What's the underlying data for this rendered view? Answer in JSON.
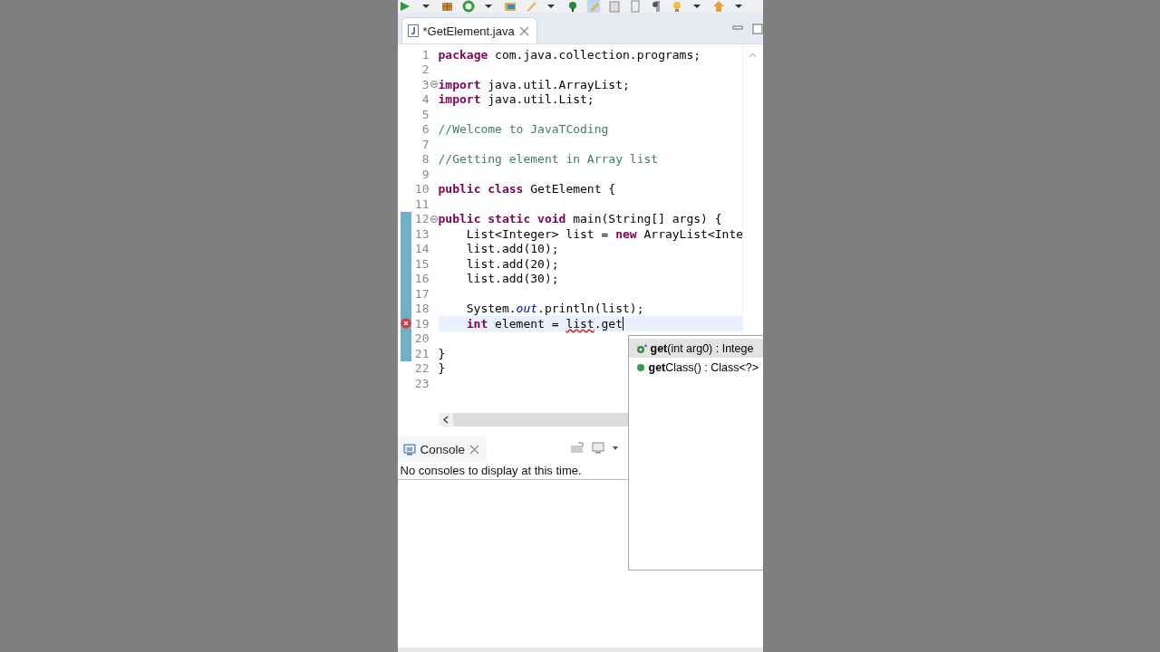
{
  "editor_tab": {
    "title": "*GetElement.java",
    "selected": true
  },
  "lines": [
    {
      "number": "1",
      "fold": false,
      "changed": false,
      "error": false,
      "current": false,
      "segments": [
        {
          "kind": "keyword",
          "text": "package"
        },
        {
          "kind": "plain",
          "text": " com.java.collection.programs;"
        }
      ]
    },
    {
      "number": "2",
      "fold": false,
      "changed": false,
      "error": false,
      "current": false
    },
    {
      "number": "3",
      "fold": true,
      "changed": false,
      "error": false,
      "current": false,
      "segments": [
        {
          "kind": "keyword",
          "text": "import"
        },
        {
          "kind": "plain",
          "text": " java.util.ArrayList;"
        }
      ]
    },
    {
      "number": "4",
      "fold": false,
      "changed": false,
      "error": false,
      "current": false,
      "segments": [
        {
          "kind": "keyword",
          "text": "import"
        },
        {
          "kind": "plain",
          "text": " java.util.List;"
        }
      ]
    },
    {
      "number": "5",
      "fold": false,
      "changed": false,
      "error": false,
      "current": false
    },
    {
      "number": "6",
      "fold": false,
      "changed": false,
      "error": false,
      "current": false,
      "segments": [
        {
          "kind": "comment",
          "text": "//Welcome to JavaTCoding"
        }
      ]
    },
    {
      "number": "7",
      "fold": false,
      "changed": false,
      "error": false,
      "current": false
    },
    {
      "number": "8",
      "fold": false,
      "changed": false,
      "error": false,
      "current": false,
      "segments": [
        {
          "kind": "comment",
          "text": "//Getting element in Array list"
        }
      ]
    },
    {
      "number": "9",
      "fold": false,
      "changed": false,
      "error": false,
      "current": false
    },
    {
      "number": "10",
      "fold": false,
      "changed": false,
      "error": false,
      "current": false,
      "segments": [
        {
          "kind": "keyword",
          "text": "public class"
        },
        {
          "kind": "plain",
          "text": " GetElement {"
        }
      ]
    },
    {
      "number": "11",
      "fold": false,
      "changed": false,
      "error": false,
      "current": false
    },
    {
      "number": "12",
      "fold": true,
      "changed": true,
      "error": false,
      "current": false,
      "segments": [
        {
          "kind": "keyword",
          "text": "public static void"
        },
        {
          "kind": "plain",
          "text": " main(String[] args) {"
        }
      ],
      "children": [
        {
          "number": "13",
          "fold": false,
          "changed": true,
          "error": false,
          "current": false,
          "segments": [
            {
              "kind": "plain",
              "text": "List<Integer> list = "
            },
            {
              "kind": "keyword",
              "text": "new"
            },
            {
              "kind": "plain",
              "text": " ArrayList<Inte"
            }
          ]
        },
        {
          "number": "14",
          "fold": false,
          "changed": true,
          "error": false,
          "current": false,
          "segments": [
            {
              "kind": "plain",
              "text": "list.add(10);"
            }
          ]
        },
        {
          "number": "15",
          "fold": false,
          "changed": true,
          "error": false,
          "current": false,
          "segments": [
            {
              "kind": "plain",
              "text": "list.add(20);"
            }
          ]
        },
        {
          "number": "16",
          "fold": false,
          "changed": true,
          "error": false,
          "current": false,
          "segments": [
            {
              "kind": "plain",
              "text": "list.add(30);"
            }
          ]
        },
        {
          "number": "17",
          "fold": false,
          "changed": true,
          "error": false,
          "current": false
        },
        {
          "number": "18",
          "fold": false,
          "changed": true,
          "error": false,
          "current": false,
          "segments": [
            {
              "kind": "plain",
              "text": "System."
            },
            {
              "kind": "field",
              "text": "out"
            },
            {
              "kind": "plain",
              "text": ".println(list);"
            }
          ]
        },
        {
          "number": "19",
          "fold": false,
          "changed": true,
          "error": true,
          "current": true,
          "segments": [
            {
              "kind": "keyword",
              "text": "int"
            },
            {
              "kind": "plain",
              "text": " element = "
            },
            {
              "kind": "error",
              "text": "list"
            },
            {
              "kind": "plain",
              "text": ".get"
            }
          ]
        },
        {
          "number": "20",
          "fold": false,
          "changed": true,
          "error": false,
          "current": false
        }
      ]
    },
    {
      "number": "21",
      "fold": false,
      "changed": true,
      "error": false,
      "current": false,
      "segments": [
        {
          "kind": "plain",
          "text": "}"
        }
      ]
    },
    {
      "number": "22",
      "fold": false,
      "changed": false,
      "error": false,
      "current": false,
      "segments": [
        {
          "kind": "plain",
          "text": "}"
        }
      ]
    },
    {
      "number": "23",
      "fold": false,
      "changed": false,
      "error": false,
      "current": false
    }
  ],
  "completion": [
    {
      "kind": "method-default",
      "label": "**get**(int arg0) : Intege",
      "selected": true
    },
    {
      "kind": "method-public",
      "label": "**get**Class() : Class<?>",
      "selected": false
    }
  ],
  "console": {
    "tab": "Console",
    "message": "No consoles to display at this time."
  }
}
